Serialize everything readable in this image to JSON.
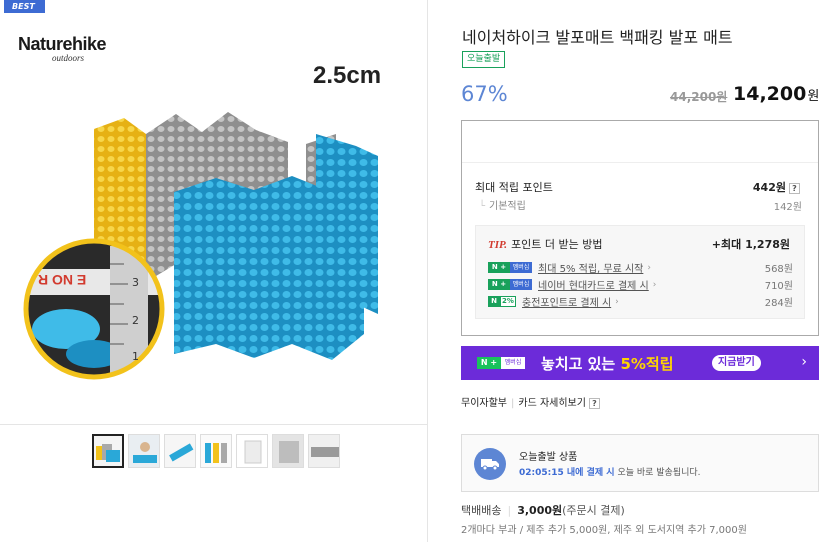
{
  "product_image": {
    "badge": "BEST",
    "brand_name": "Naturehike",
    "brand_sub": "outdoors",
    "thickness_label": "2.5cm",
    "ruler_text": "E NO R",
    "ruler_numbers": [
      "3",
      "2",
      "1"
    ]
  },
  "thumbnails": [
    "thumb-1",
    "thumb-2",
    "thumb-3",
    "thumb-4",
    "thumb-5",
    "thumb-6",
    "thumb-7"
  ],
  "product": {
    "title": "네이처하이크 발포매트 백패킹 발포 매트",
    "today_badge": "오늘출발",
    "discount": "67%",
    "original_price": "44,200원",
    "sale_price": "14,200",
    "sale_unit": "원"
  },
  "points": {
    "max_label": "최대 적립 포인트",
    "max_value": "442원",
    "base_label": "기본적립",
    "base_value": "142원",
    "tip_word": "TIP.",
    "tip_title": "포인트 더 받는 방법",
    "tip_max": "+최대 1,278원",
    "tip_rows": [
      {
        "tag_n": "N",
        "tag_m": "멤버십",
        "text": "최대 5% 적립, 무료 시작",
        "amount": "568원"
      },
      {
        "tag_n": "N",
        "tag_m": "멤버십",
        "text": "네이버 현대카드로 결제 시",
        "amount": "710원"
      },
      {
        "tag_n": "N",
        "tag_p": "2%",
        "text": "충전포인트로 결제 시",
        "amount": "284원"
      }
    ]
  },
  "promo": {
    "tag_n": "N +",
    "tag_m": "멤버십",
    "text_main": "놓치고 있는 ",
    "text_highlight": "5%적립",
    "button": "지금받기"
  },
  "card_links": {
    "installment": "무이자할부",
    "card_detail": "카드 자세히보기"
  },
  "shipping": {
    "title": "오늘출발 상품",
    "time": "02:05:15 내에 결제 시",
    "desc": " 오늘 바로 발송됩니다."
  },
  "delivery": {
    "label": "택배배송",
    "price": "3,000원",
    "condition": "(주문시 결제)",
    "note": "2개마다 부과 / 제주 추가 5,000원, 제주 외 도서지역 추가 7,000원"
  },
  "colors": {
    "accent_blue": "#5d86d4",
    "green": "#19a15b",
    "promo_purple": "#6c2bd9",
    "mat_blue": "#2aa8d8",
    "mat_yellow": "#f2c21b",
    "mat_silver": "#a9a9a9"
  }
}
